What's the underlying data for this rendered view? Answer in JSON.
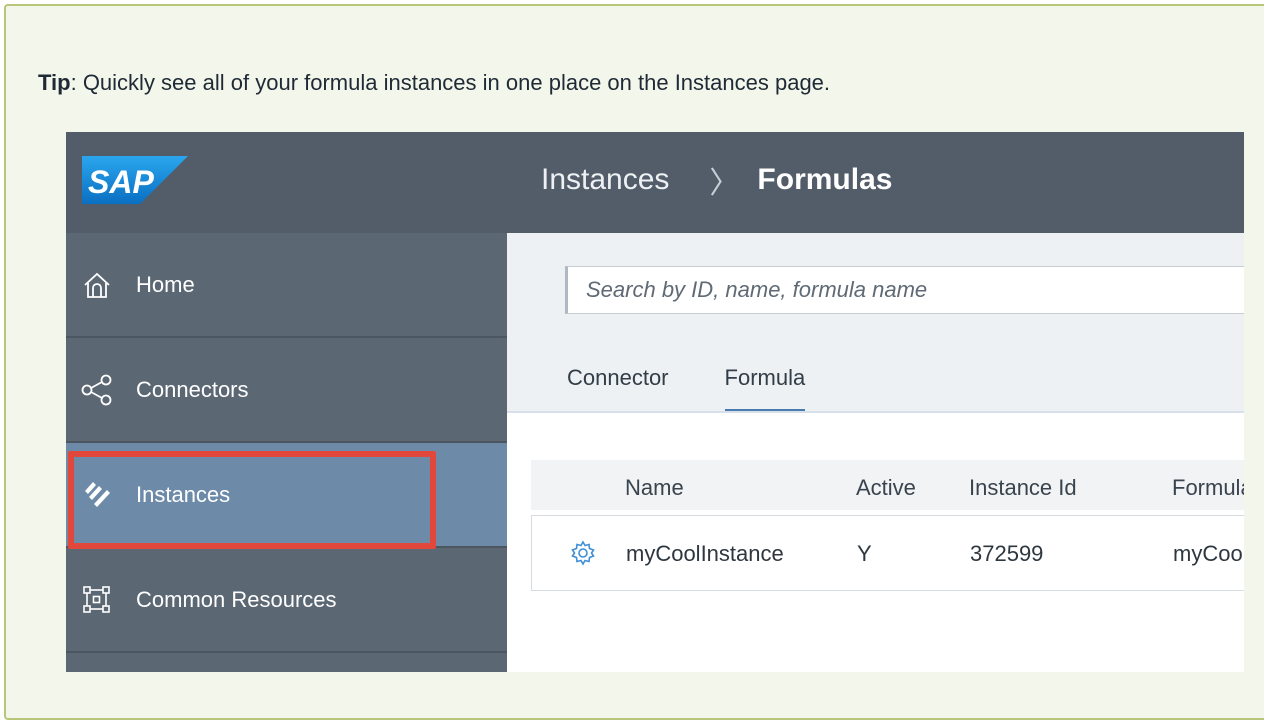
{
  "tip": {
    "label": "Tip",
    "text": ": Quickly see all of your formula instances in one place on the Instances page."
  },
  "header": {
    "logo_text": "SAP",
    "breadcrumb_parent": "Instances",
    "breadcrumb_separator": "〉",
    "breadcrumb_current": "Formulas"
  },
  "sidebar": {
    "items": [
      {
        "label": "Home",
        "icon": "home-icon"
      },
      {
        "label": "Connectors",
        "icon": "share-icon"
      },
      {
        "label": "Instances",
        "icon": "instances-icon",
        "active": true
      },
      {
        "label": "Common Resources",
        "icon": "network-icon"
      }
    ]
  },
  "search": {
    "placeholder": "Search by ID, name, formula name"
  },
  "tabs": [
    {
      "label": "Connector",
      "active": false
    },
    {
      "label": "Formula",
      "active": true
    }
  ],
  "table": {
    "columns": [
      "Name",
      "Active",
      "Instance Id",
      "Formula"
    ],
    "rows": [
      {
        "name": "myCoolInstance",
        "active": "Y",
        "instance_id": "372599",
        "formula": "myCoolFormula"
      }
    ]
  },
  "colors": {
    "header_bg": "#525d69",
    "sidebar_bg": "#5b6773",
    "sidebar_active_bg": "#6d8ba9",
    "highlight": "#e2473c",
    "sap_blue": "#1a8fd8",
    "tab_underline": "#4a7bb0"
  }
}
